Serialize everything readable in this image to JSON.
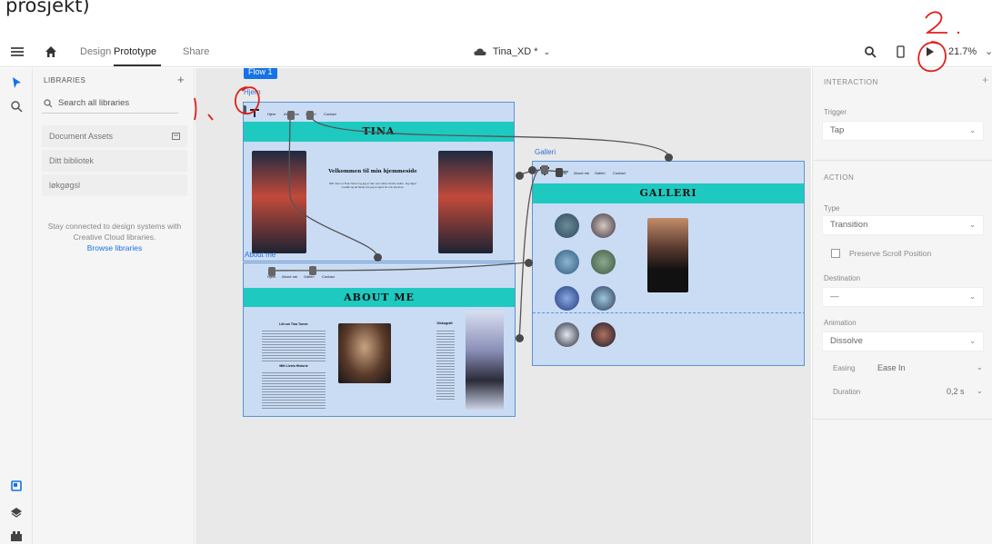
{
  "doc_fragment": "prosjekt)",
  "topbar": {
    "tabs": [
      "Design",
      "Prototype",
      "Share"
    ],
    "active_tab": "Prototype",
    "document_title": "Tina_XD *",
    "zoom": "21.7%"
  },
  "libraries": {
    "header": "LIBRARIES",
    "search_placeholder": "Search all libraries",
    "items": [
      "Document Assets",
      "Ditt bibliotek",
      "løkgøgsl"
    ],
    "note": "Stay connected to design systems with Creative Cloud libraries.",
    "link": "Browse libraries"
  },
  "canvas": {
    "flow_label": "Flow 1",
    "artboards": {
      "home": {
        "label": "Hjem",
        "banner": "TINA",
        "nav": [
          "Hjem",
          "About me",
          "Galleri",
          "Contact"
        ],
        "heading": "Velkommen til min hjemmeside",
        "body": "Mitt navn er Tina Turner og jeg er den som skrev denne siden. Jeg lager musikk og de fleste tror jeg er kjent for min stemme."
      },
      "gallery": {
        "label": "Galleri",
        "banner": "GALLERI",
        "nav": [
          "Hjem",
          "About me",
          "Galleri",
          "Contact"
        ]
      },
      "about": {
        "label": "About me",
        "banner": "ABOUT ME",
        "nav": [
          "Hjem",
          "About me",
          "Galleri",
          "Contact"
        ],
        "heading": "Litt om Tina Turner",
        "sub": "Mitt Livets Historie",
        "side_heading": "Diskografi"
      }
    }
  },
  "interaction": {
    "header": "INTERACTION",
    "trigger_label": "Trigger",
    "trigger_value": "Tap",
    "action_header": "ACTION",
    "type_label": "Type",
    "type_value": "Transition",
    "preserve_label": "Preserve Scroll Position",
    "destination_label": "Destination",
    "destination_value": "—",
    "animation_label": "Animation",
    "animation_value": "Dissolve",
    "easing_label": "Easing",
    "easing_value": "Ease In",
    "duration_label": "Duration",
    "duration_value": "0,2 s"
  },
  "annotations": {
    "one": "1.",
    "two": "2."
  }
}
